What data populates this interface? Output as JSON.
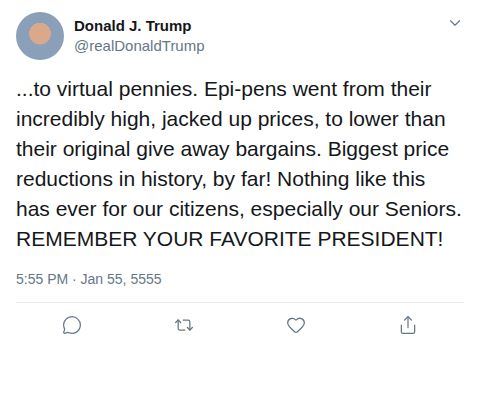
{
  "user": {
    "name": "Donald J. Trump",
    "handle": "@realDonaldTrump"
  },
  "tweet": {
    "text": "...to virtual pennies. Epi-pens went from their incredibly high, jacked up prices, to lower than their original give away bargains. Biggest price reductions in history, by far! Nothing like this has ever for our citizens, especially our Seniors. REMEMBER YOUR FAVORITE PRESIDENT!",
    "timestamp": "5:55 PM · Jan 55, 5555"
  }
}
